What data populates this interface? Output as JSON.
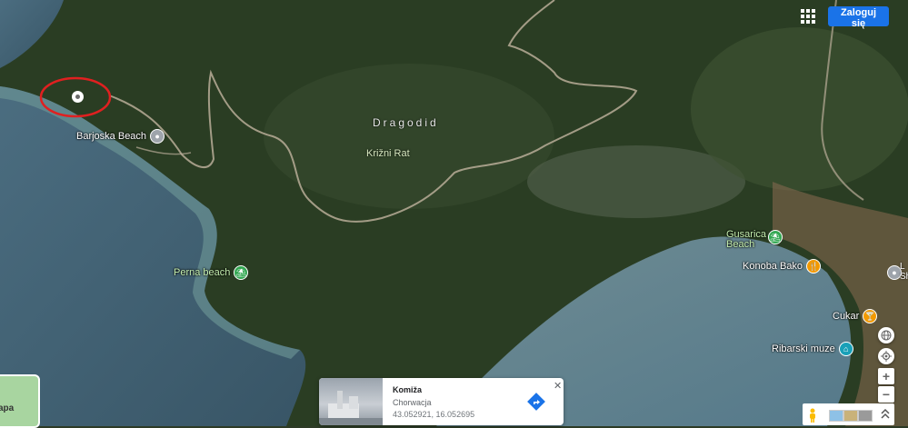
{
  "header": {
    "signin_label": "Zaloguj się"
  },
  "places": {
    "barjoska": "Barjoska Beach",
    "dragodid": "Dragodid",
    "krizni_rat": "Križni Rat",
    "gusarica": "Gusarica Beach",
    "perna": "Perna beach",
    "konoba": "Konoba Bako",
    "cukar": "Cukar",
    "ribarski": "Ribarski muze",
    "edge_l": "L",
    "edge_s": "Sh"
  },
  "layer_switcher": {
    "label": "apa"
  },
  "info_card": {
    "title": "Komiža",
    "subtitle": "Chorwacja",
    "coordinates": "43.052921, 16.052695"
  },
  "icons": {
    "apps": "apps-grid-icon",
    "directions": "directions-icon",
    "close": "close-icon",
    "globe": "globe-icon",
    "location": "my-location-icon",
    "zoom_in": "plus-icon",
    "zoom_out": "minus-icon",
    "pegman": "pegman-icon",
    "expand": "expand-icon"
  },
  "colors": {
    "accent": "#1a73e8",
    "selection_ring": "#e02020",
    "sea": "#3f6277",
    "land": "#263a22"
  }
}
